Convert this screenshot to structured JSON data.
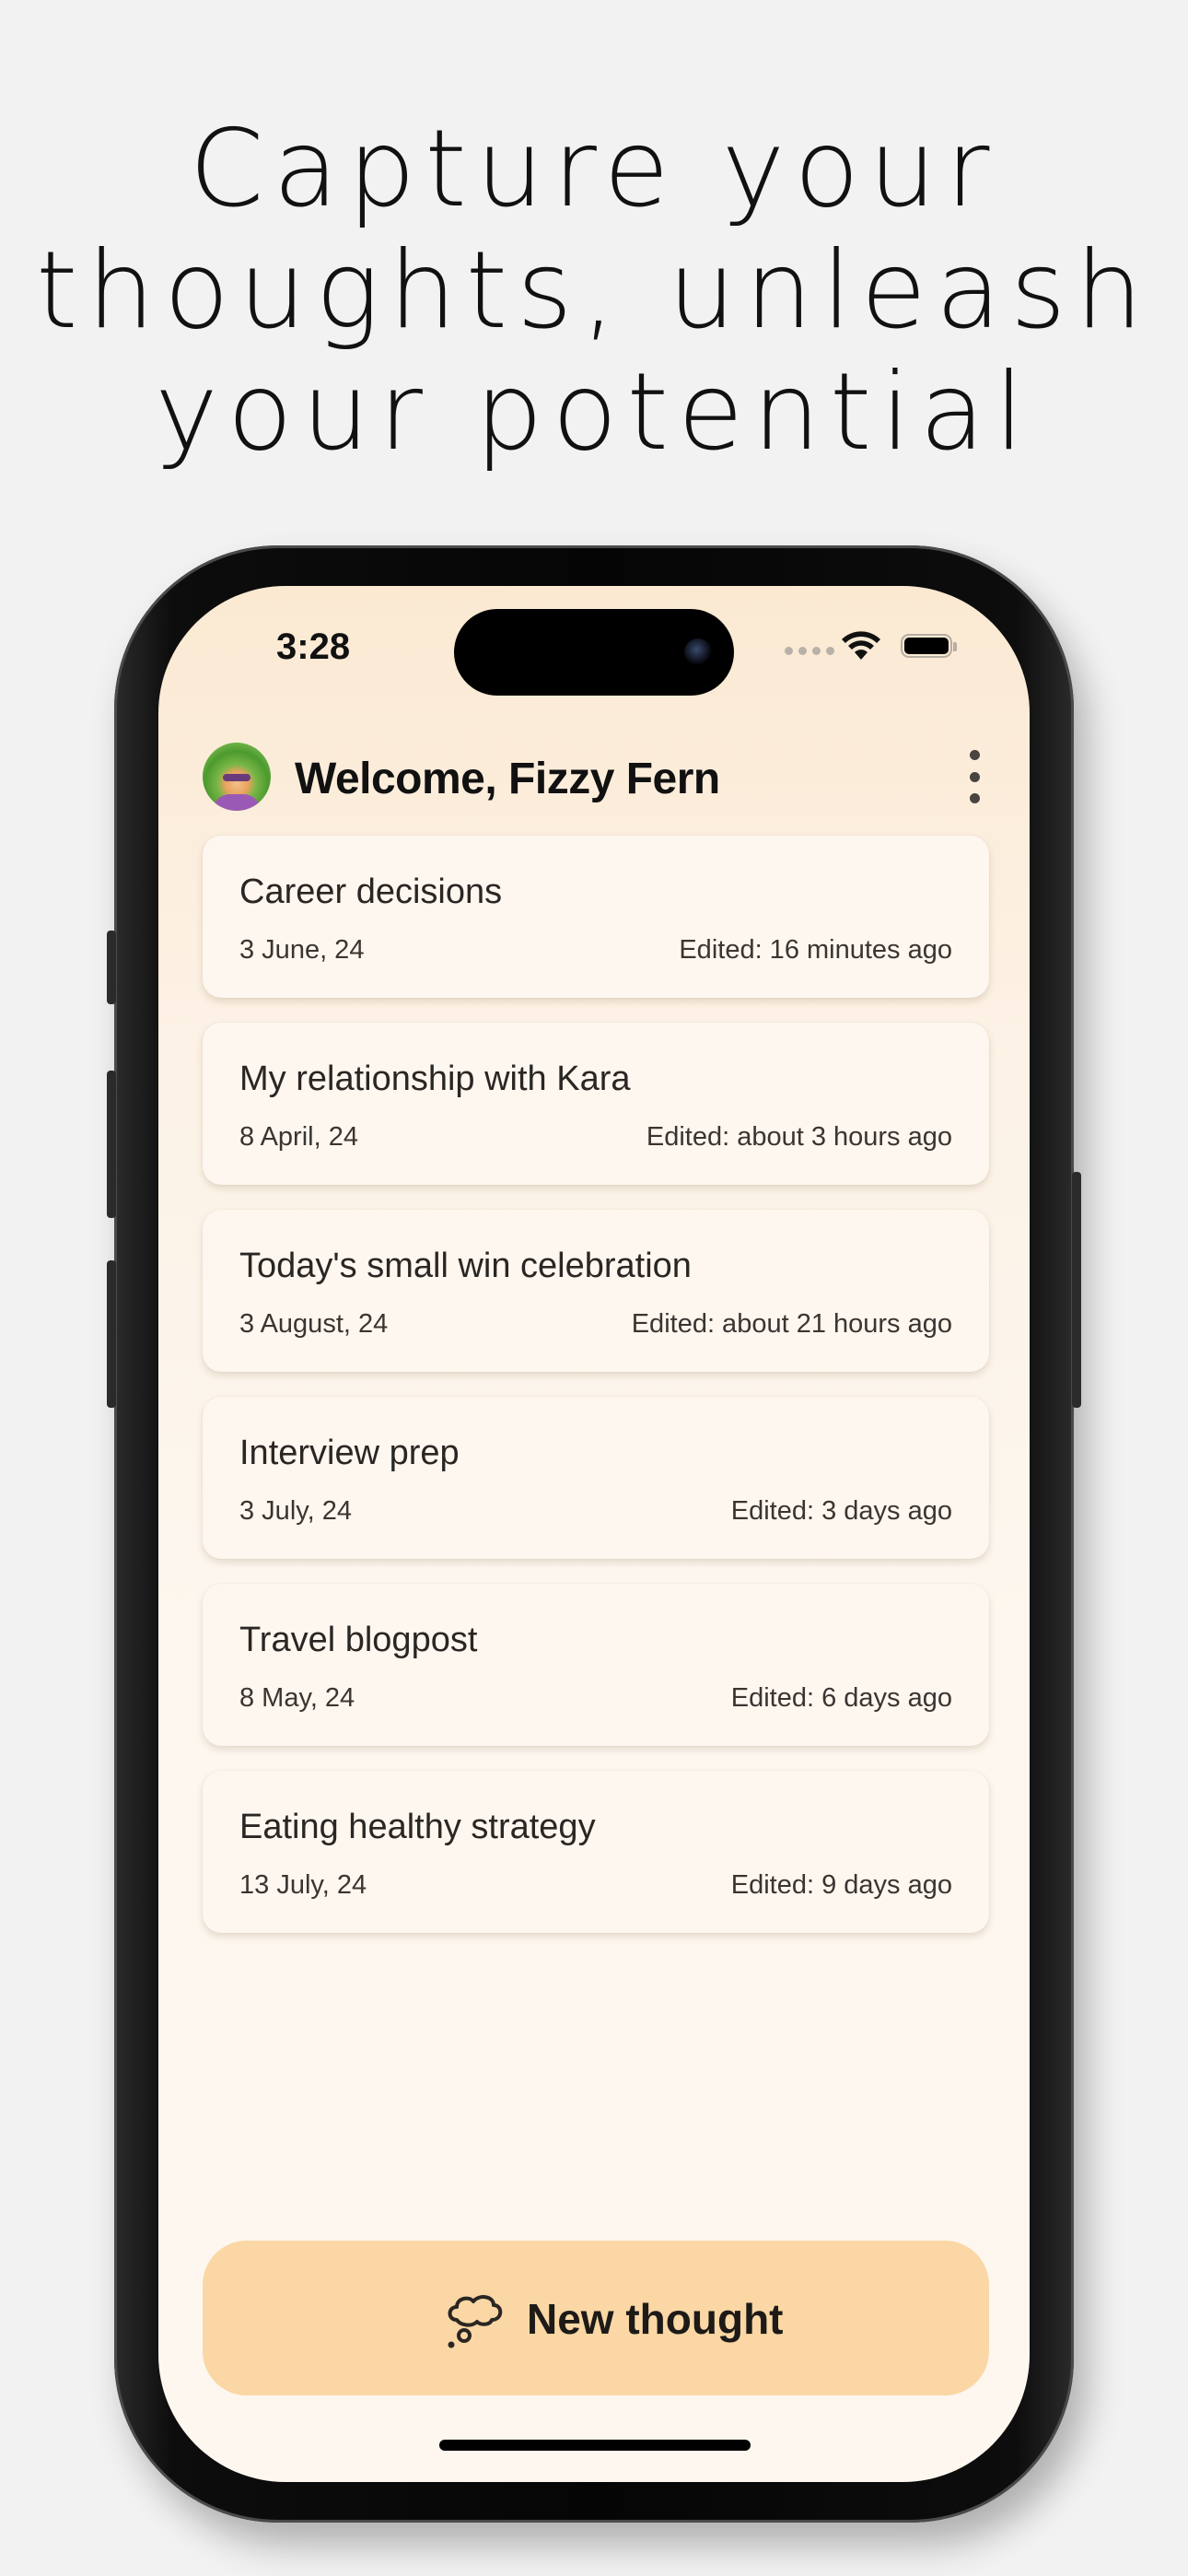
{
  "headline": {
    "line1": "Capture your",
    "line2": "thoughts, unleash",
    "line3": "your potential"
  },
  "status_bar": {
    "time": "3:28",
    "icons": [
      "signal-dots-icon",
      "wifi-icon",
      "battery-icon"
    ]
  },
  "header": {
    "welcome_text": "Welcome, Fizzy Fern",
    "avatar": "avatar-image",
    "menu_icon": "more-vertical-icon"
  },
  "thoughts": [
    {
      "title": "Career decisions",
      "date": "3 June, 24",
      "edited": "Edited: 16 minutes ago"
    },
    {
      "title": "My relationship with Kara",
      "date": "8 April, 24",
      "edited": "Edited: about 3 hours ago"
    },
    {
      "title": "Today's small win celebration",
      "date": "3 August, 24",
      "edited": "Edited: about 21 hours ago"
    },
    {
      "title": "Interview prep",
      "date": "3 July, 24",
      "edited": "Edited: 3 days ago"
    },
    {
      "title": "Travel blogpost",
      "date": "8 May, 24",
      "edited": "Edited: 6 days ago"
    },
    {
      "title": "Eating healthy strategy",
      "date": "13 July, 24",
      "edited": "Edited: 9 days ago"
    }
  ],
  "new_thought_button": {
    "label": "New thought",
    "icon": "thought-bubble-icon"
  },
  "colors": {
    "background": "#f2f2f2",
    "screen_top": "#fbe9d2",
    "screen_bottom": "#fdf7ef",
    "card": "#fdf7ef",
    "button": "#fad7a4",
    "text": "#111111"
  }
}
